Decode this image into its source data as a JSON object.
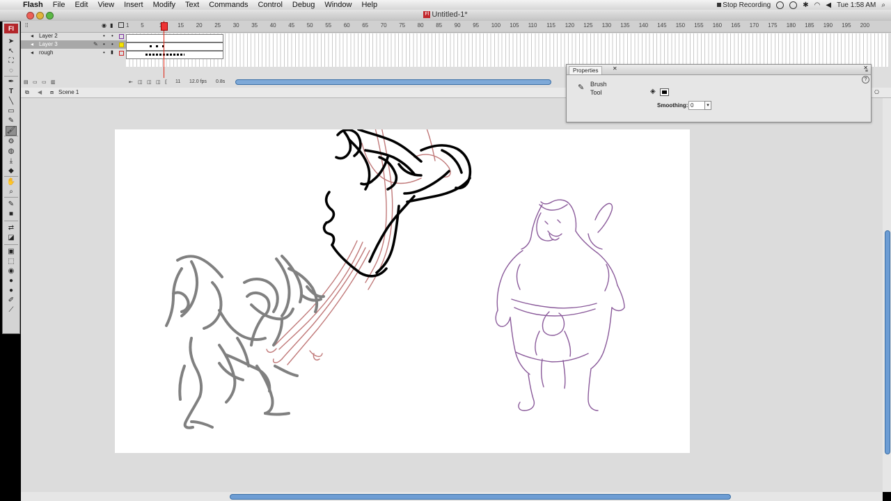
{
  "menubar": {
    "app": "Flash",
    "items": [
      "File",
      "Edit",
      "View",
      "Insert",
      "Modify",
      "Text",
      "Commands",
      "Control",
      "Debug",
      "Window",
      "Help"
    ],
    "status_recording": "Stop Recording",
    "clock": "Tue 1:58 AM"
  },
  "window": {
    "title": "Untitled-1*"
  },
  "tools": {
    "logo": "Fl"
  },
  "timeline": {
    "layers": [
      {
        "name": "Layer 2"
      },
      {
        "name": "Layer 3"
      },
      {
        "name": "rough"
      }
    ],
    "ruler": [
      "1",
      "5",
      "10",
      "15",
      "20",
      "25",
      "30",
      "35",
      "40",
      "45",
      "50",
      "55",
      "60",
      "65",
      "70",
      "75",
      "80",
      "85",
      "90",
      "95",
      "100",
      "105",
      "110",
      "115",
      "120",
      "125",
      "130",
      "135",
      "140",
      "145",
      "150",
      "155",
      "160",
      "165",
      "170",
      "175",
      "180",
      "185",
      "190",
      "195",
      "200"
    ],
    "current_frame": "11",
    "fps": "12.0 fps",
    "elapsed": "0.8s"
  },
  "editbar": {
    "scene": "Scene 1"
  },
  "properties": {
    "tab": "Properties",
    "tool_name_1": "Brush",
    "tool_name_2": "Tool",
    "smoothing_label": "Smoothing:",
    "smoothing_value": "0"
  },
  "colors": {
    "playhead": "#dd2222",
    "scroll_thumb": "#6d9dd4",
    "rough_stroke": "#808080",
    "ink_stroke": "#000000",
    "onion_red": "#c07878",
    "onion_purple": "#8a5a9a"
  }
}
